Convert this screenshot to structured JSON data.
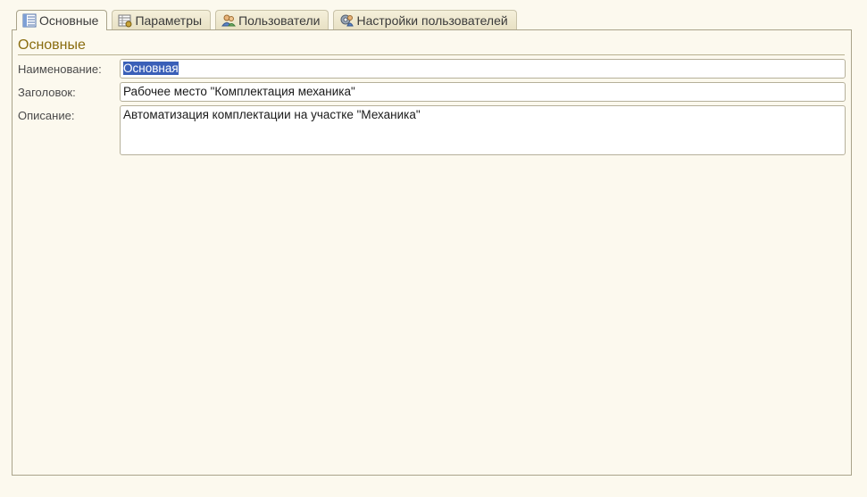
{
  "tabs": [
    {
      "label": "Основные",
      "icon": "list-icon",
      "active": true
    },
    {
      "label": "Параметры",
      "icon": "settings-table-icon",
      "active": false
    },
    {
      "label": "Пользователи",
      "icon": "users-icon",
      "active": false
    },
    {
      "label": "Настройки пользователей",
      "icon": "user-settings-icon",
      "active": false
    }
  ],
  "group": {
    "title": "Основные"
  },
  "fields": {
    "name": {
      "label": "Наименование:",
      "value": "Основная"
    },
    "header": {
      "label": "Заголовок:",
      "value": "Рабочее место \"Комплектация механика\""
    },
    "description": {
      "label": "Описание:",
      "value": "Автоматизация комплектации на участке \"Механика\""
    }
  },
  "colors": {
    "background": "#fcf9ee",
    "group_title": "#8a6d10",
    "selection": "#3a5fb8"
  }
}
